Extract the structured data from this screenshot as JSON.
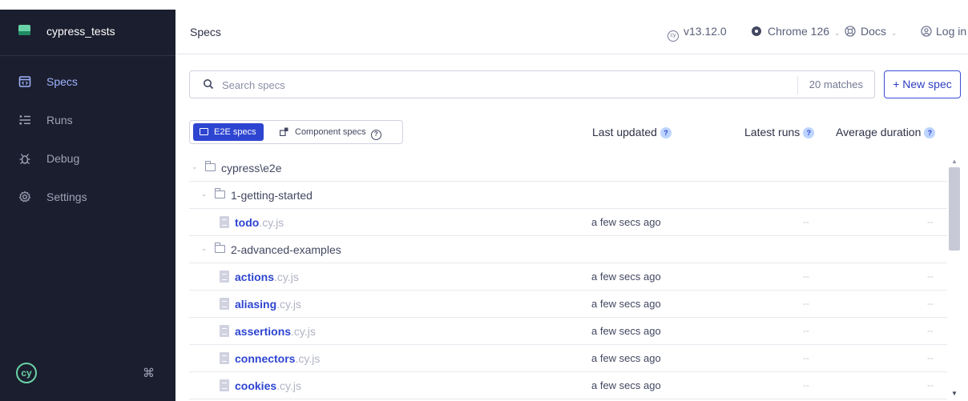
{
  "sidebar": {
    "project_name": "cypress_tests",
    "items": [
      {
        "label": "Specs",
        "icon": "specs-icon"
      },
      {
        "label": "Runs",
        "icon": "runs-icon"
      },
      {
        "label": "Debug",
        "icon": "debug-icon"
      },
      {
        "label": "Settings",
        "icon": "settings-icon"
      }
    ],
    "active": "Specs",
    "logo_text": "cy",
    "shortcut_glyph": "⌘"
  },
  "header": {
    "title": "Specs",
    "version": "v13.12.0",
    "browser": "Chrome 126",
    "docs": "Docs",
    "login": "Log in"
  },
  "search": {
    "placeholder": "Search specs",
    "matches": "20 matches",
    "new_spec": "+ New spec"
  },
  "toggle": {
    "e2e": "E2E specs",
    "component": "Component specs",
    "help_glyph": "?"
  },
  "columns": {
    "last_updated": "Last updated",
    "latest_runs": "Latest runs",
    "average_duration": "Average duration",
    "help_glyph": "?"
  },
  "rows": [
    {
      "type": "folder",
      "name": "cypress\\e2e"
    },
    {
      "type": "folder",
      "name": "1-getting-started"
    },
    {
      "type": "spec",
      "name": "todo",
      "ext": ".cy.js",
      "updated": "a few secs ago",
      "runs": "--",
      "duration": "--"
    },
    {
      "type": "folder",
      "name": "2-advanced-examples"
    },
    {
      "type": "spec",
      "name": "actions",
      "ext": ".cy.js",
      "updated": "a few secs ago",
      "runs": "--",
      "duration": "--"
    },
    {
      "type": "spec",
      "name": "aliasing",
      "ext": ".cy.js",
      "updated": "a few secs ago",
      "runs": "--",
      "duration": "--"
    },
    {
      "type": "spec",
      "name": "assertions",
      "ext": ".cy.js",
      "updated": "a few secs ago",
      "runs": "--",
      "duration": "--"
    },
    {
      "type": "spec",
      "name": "connectors",
      "ext": ".cy.js",
      "updated": "a few secs ago",
      "runs": "--",
      "duration": "--"
    },
    {
      "type": "spec",
      "name": "cookies",
      "ext": ".cy.js",
      "updated": "a few secs ago",
      "runs": "--",
      "duration": "--"
    }
  ],
  "colors": {
    "sidebar_bg": "#1b1e2e",
    "accent": "#2e45d1",
    "active_nav": "#9fb4ff",
    "brand_green": "#69d3a7"
  }
}
